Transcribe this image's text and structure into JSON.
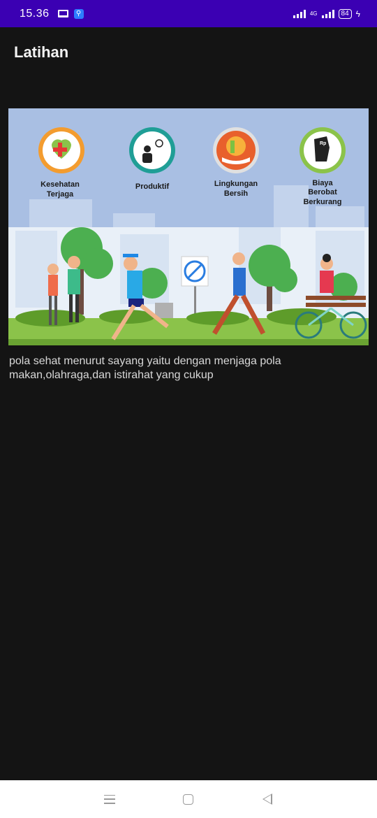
{
  "status_bar": {
    "time": "15.36",
    "network": "4G",
    "battery": "84"
  },
  "app_bar": {
    "title": "Latihan"
  },
  "hero_image": {
    "icons": [
      {
        "label_line1": "Kesehatan",
        "label_line2": "Terjaga",
        "icon": "health-heart-icon"
      },
      {
        "label_line1": "Produktif",
        "label_line2": "",
        "icon": "productive-idea-icon"
      },
      {
        "label_line1": "Lingkungan",
        "label_line2": "Bersih",
        "icon": "clean-environment-icon"
      },
      {
        "label_line1": "Biaya",
        "label_line2": "Berobat",
        "label_line3": "Berkurang",
        "icon": "reduced-cost-icon",
        "badge": "Rp"
      }
    ]
  },
  "content": {
    "description": "pola sehat menurut sayang yaitu dengan menjaga pola makan,olahraga,dan istirahat yang cukup"
  },
  "colors": {
    "status_bar": "#3b00b3",
    "background": "#141414",
    "hero_sky": "#a9bfe3",
    "grass": "#8bc34a"
  }
}
